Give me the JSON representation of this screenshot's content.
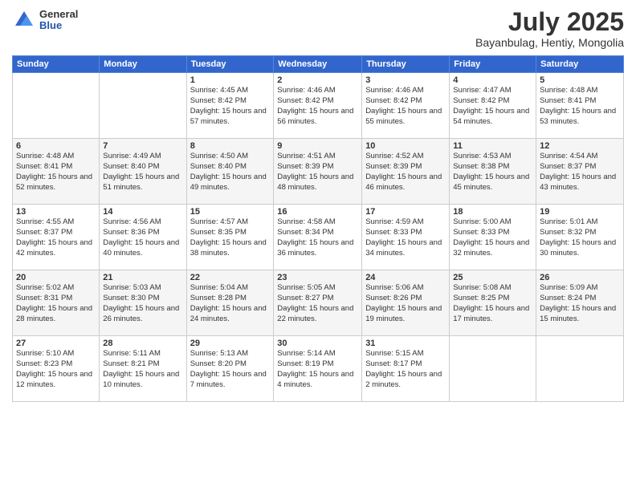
{
  "header": {
    "logo_general": "General",
    "logo_blue": "Blue",
    "month_year": "July 2025",
    "location": "Bayanbulag, Hentiy, Mongolia"
  },
  "weekdays": [
    "Sunday",
    "Monday",
    "Tuesday",
    "Wednesday",
    "Thursday",
    "Friday",
    "Saturday"
  ],
  "weeks": [
    [
      {
        "day": "",
        "info": ""
      },
      {
        "day": "",
        "info": ""
      },
      {
        "day": "1",
        "info": "Sunrise: 4:45 AM\nSunset: 8:42 PM\nDaylight: 15 hours and 57 minutes."
      },
      {
        "day": "2",
        "info": "Sunrise: 4:46 AM\nSunset: 8:42 PM\nDaylight: 15 hours and 56 minutes."
      },
      {
        "day": "3",
        "info": "Sunrise: 4:46 AM\nSunset: 8:42 PM\nDaylight: 15 hours and 55 minutes."
      },
      {
        "day": "4",
        "info": "Sunrise: 4:47 AM\nSunset: 8:42 PM\nDaylight: 15 hours and 54 minutes."
      },
      {
        "day": "5",
        "info": "Sunrise: 4:48 AM\nSunset: 8:41 PM\nDaylight: 15 hours and 53 minutes."
      }
    ],
    [
      {
        "day": "6",
        "info": "Sunrise: 4:48 AM\nSunset: 8:41 PM\nDaylight: 15 hours and 52 minutes."
      },
      {
        "day": "7",
        "info": "Sunrise: 4:49 AM\nSunset: 8:40 PM\nDaylight: 15 hours and 51 minutes."
      },
      {
        "day": "8",
        "info": "Sunrise: 4:50 AM\nSunset: 8:40 PM\nDaylight: 15 hours and 49 minutes."
      },
      {
        "day": "9",
        "info": "Sunrise: 4:51 AM\nSunset: 8:39 PM\nDaylight: 15 hours and 48 minutes."
      },
      {
        "day": "10",
        "info": "Sunrise: 4:52 AM\nSunset: 8:39 PM\nDaylight: 15 hours and 46 minutes."
      },
      {
        "day": "11",
        "info": "Sunrise: 4:53 AM\nSunset: 8:38 PM\nDaylight: 15 hours and 45 minutes."
      },
      {
        "day": "12",
        "info": "Sunrise: 4:54 AM\nSunset: 8:37 PM\nDaylight: 15 hours and 43 minutes."
      }
    ],
    [
      {
        "day": "13",
        "info": "Sunrise: 4:55 AM\nSunset: 8:37 PM\nDaylight: 15 hours and 42 minutes."
      },
      {
        "day": "14",
        "info": "Sunrise: 4:56 AM\nSunset: 8:36 PM\nDaylight: 15 hours and 40 minutes."
      },
      {
        "day": "15",
        "info": "Sunrise: 4:57 AM\nSunset: 8:35 PM\nDaylight: 15 hours and 38 minutes."
      },
      {
        "day": "16",
        "info": "Sunrise: 4:58 AM\nSunset: 8:34 PM\nDaylight: 15 hours and 36 minutes."
      },
      {
        "day": "17",
        "info": "Sunrise: 4:59 AM\nSunset: 8:33 PM\nDaylight: 15 hours and 34 minutes."
      },
      {
        "day": "18",
        "info": "Sunrise: 5:00 AM\nSunset: 8:33 PM\nDaylight: 15 hours and 32 minutes."
      },
      {
        "day": "19",
        "info": "Sunrise: 5:01 AM\nSunset: 8:32 PM\nDaylight: 15 hours and 30 minutes."
      }
    ],
    [
      {
        "day": "20",
        "info": "Sunrise: 5:02 AM\nSunset: 8:31 PM\nDaylight: 15 hours and 28 minutes."
      },
      {
        "day": "21",
        "info": "Sunrise: 5:03 AM\nSunset: 8:30 PM\nDaylight: 15 hours and 26 minutes."
      },
      {
        "day": "22",
        "info": "Sunrise: 5:04 AM\nSunset: 8:28 PM\nDaylight: 15 hours and 24 minutes."
      },
      {
        "day": "23",
        "info": "Sunrise: 5:05 AM\nSunset: 8:27 PM\nDaylight: 15 hours and 22 minutes."
      },
      {
        "day": "24",
        "info": "Sunrise: 5:06 AM\nSunset: 8:26 PM\nDaylight: 15 hours and 19 minutes."
      },
      {
        "day": "25",
        "info": "Sunrise: 5:08 AM\nSunset: 8:25 PM\nDaylight: 15 hours and 17 minutes."
      },
      {
        "day": "26",
        "info": "Sunrise: 5:09 AM\nSunset: 8:24 PM\nDaylight: 15 hours and 15 minutes."
      }
    ],
    [
      {
        "day": "27",
        "info": "Sunrise: 5:10 AM\nSunset: 8:23 PM\nDaylight: 15 hours and 12 minutes."
      },
      {
        "day": "28",
        "info": "Sunrise: 5:11 AM\nSunset: 8:21 PM\nDaylight: 15 hours and 10 minutes."
      },
      {
        "day": "29",
        "info": "Sunrise: 5:13 AM\nSunset: 8:20 PM\nDaylight: 15 hours and 7 minutes."
      },
      {
        "day": "30",
        "info": "Sunrise: 5:14 AM\nSunset: 8:19 PM\nDaylight: 15 hours and 4 minutes."
      },
      {
        "day": "31",
        "info": "Sunrise: 5:15 AM\nSunset: 8:17 PM\nDaylight: 15 hours and 2 minutes."
      },
      {
        "day": "",
        "info": ""
      },
      {
        "day": "",
        "info": ""
      }
    ]
  ]
}
